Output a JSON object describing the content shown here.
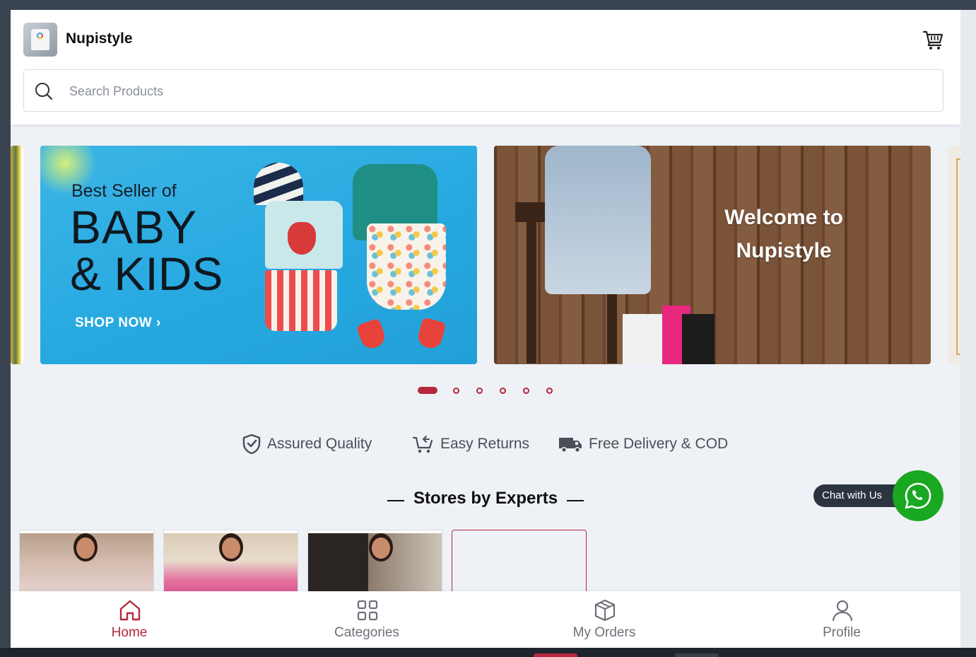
{
  "header": {
    "brand": "Nupistyle",
    "logo_icon": "tshirt-logo-icon",
    "cart_icon": "shopping-cart-icon"
  },
  "search": {
    "placeholder": "Search Products",
    "value": "",
    "icon": "search-icon"
  },
  "carousel": {
    "slide1": {
      "line1": "Best Seller of",
      "line2": "BABY",
      "line3": "& KIDS",
      "cta": "SHOP NOW ›"
    },
    "slide2": {
      "line1": "Welcome to",
      "line2": "Nupistyle"
    },
    "dot_count": 6,
    "active_index": 0
  },
  "features": [
    {
      "label": "Assured Quality",
      "icon": "shield-check-icon"
    },
    {
      "label": "Easy Returns",
      "icon": "cart-return-icon"
    },
    {
      "label": "Free Delivery & COD",
      "icon": "truck-icon"
    }
  ],
  "stores": {
    "heading": "Stores by Experts"
  },
  "chat": {
    "label": "Chat with Us",
    "icon": "whatsapp-icon"
  },
  "nav": {
    "items": [
      {
        "label": "Home",
        "icon": "home-icon",
        "active": true
      },
      {
        "label": "Categories",
        "icon": "grid-icon",
        "active": false
      },
      {
        "label": "My Orders",
        "icon": "package-icon",
        "active": false
      },
      {
        "label": "Profile",
        "icon": "user-icon",
        "active": false
      }
    ]
  },
  "colors": {
    "accent": "#b5283e",
    "whatsapp": "#1aa722",
    "background": "#eef1f5"
  }
}
